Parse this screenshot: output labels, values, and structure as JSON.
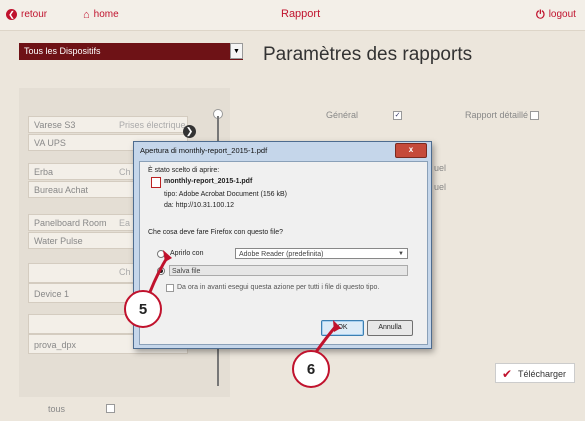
{
  "topbar": {
    "back_label": "retour",
    "home_label": "home",
    "title": "Rapport",
    "logout_label": "logout"
  },
  "device_select": {
    "value": "Tous les Dispositifs"
  },
  "page_heading": "Paramètres des rapports",
  "devices": [
    {
      "name": "Varese S3",
      "detail": "Prises électrique"
    },
    {
      "name": "VA UPS",
      "detail": ""
    },
    {
      "name": "Erba",
      "detail": "Ch"
    },
    {
      "name": "Bureau Achat",
      "detail": ""
    },
    {
      "name": "Panelboard Room",
      "detail": "Ea"
    },
    {
      "name": "Water Pulse",
      "detail": ""
    },
    {
      "name": "",
      "detail": "Ch"
    },
    {
      "name": "Device 1",
      "detail": ""
    },
    {
      "name": "prova_dpx",
      "detail": ""
    }
  ],
  "options": {
    "general_label": "Général",
    "general_checked": true,
    "detailed_label": "Rapport détaillé",
    "detailed_checked": false,
    "partial1": "uel",
    "partial2": "uel"
  },
  "tous_label": "tous",
  "download_label": "Télécharger",
  "dialog": {
    "title": "Apertura di monthly-report_2015-1.pdf",
    "close_label": "x",
    "intro": "È stato scelto di aprire:",
    "filename": "monthly-report_2015-1.pdf",
    "type_line": "tipo: Adobe Acrobat Document (156 kB)",
    "from_line": "da: http://10.31.100.12",
    "question": "Che cosa deve fare Firefox con questo file?",
    "open_with_label": "Aprirlo con",
    "open_with_app": "Adobe Reader (predefinita)",
    "save_label": "Salva file",
    "auto_label": "Da ora in avanti esegui questa azione per tutti i file di questo tipo.",
    "ok_label": "OK",
    "cancel_label": "Annulla"
  },
  "callouts": {
    "step5": "5",
    "step6": "6"
  },
  "colors": {
    "accent": "#c0122d",
    "dark_select": "#6e1216"
  }
}
